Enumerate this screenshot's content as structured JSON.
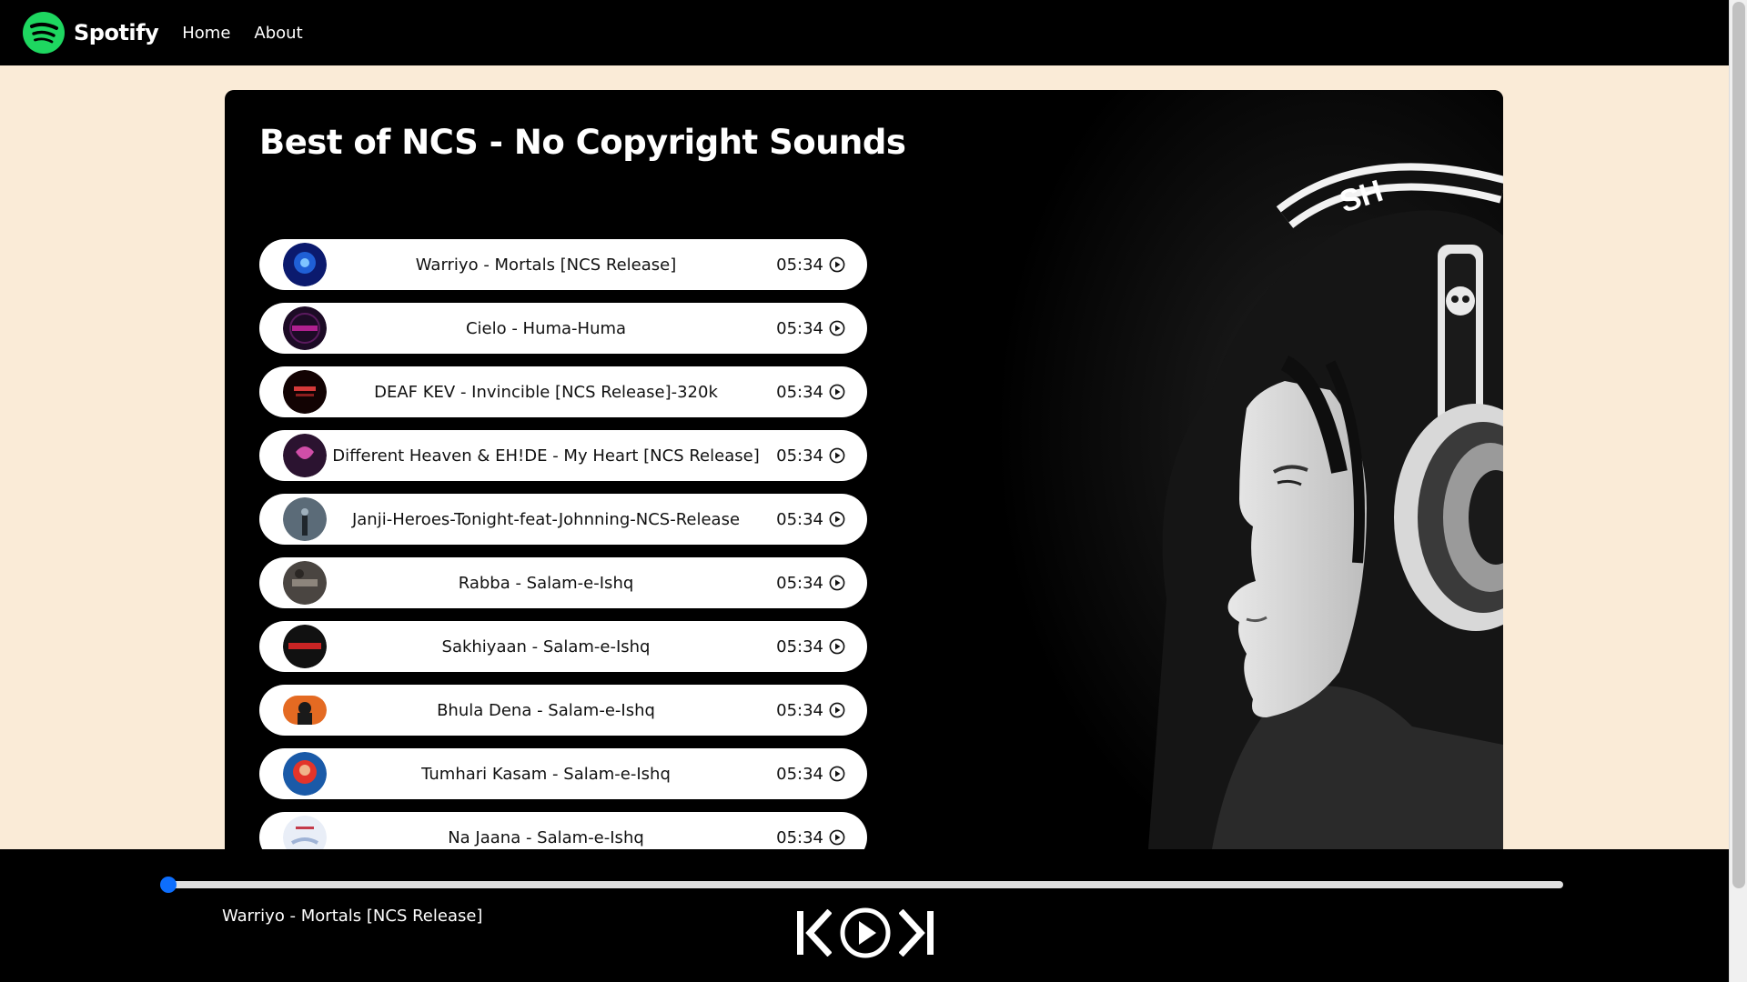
{
  "nav": {
    "brand": "Spotify",
    "links": [
      "Home",
      "About"
    ]
  },
  "playlist": {
    "title": "Best of NCS - No Copyright Sounds"
  },
  "songs": [
    {
      "name": "Warriyo - Mortals [NCS Release]",
      "duration": "05:34"
    },
    {
      "name": "Cielo - Huma-Huma",
      "duration": "05:34"
    },
    {
      "name": "DEAF KEV - Invincible [NCS Release]-320k",
      "duration": "05:34"
    },
    {
      "name": "Different Heaven & EH!DE - My Heart [NCS Release]",
      "duration": "05:34"
    },
    {
      "name": "Janji-Heroes-Tonight-feat-Johnning-NCS-Release",
      "duration": "05:34"
    },
    {
      "name": "Rabba - Salam-e-Ishq",
      "duration": "05:34"
    },
    {
      "name": "Sakhiyaan - Salam-e-Ishq",
      "duration": "05:34"
    },
    {
      "name": "Bhula Dena - Salam-e-Ishq",
      "duration": "05:34"
    },
    {
      "name": "Tumhari Kasam - Salam-e-Ishq",
      "duration": "05:34"
    },
    {
      "name": "Na Jaana - Salam-e-Ishq",
      "duration": "05:34"
    }
  ],
  "player": {
    "now_playing": "Warriyo - Mortals [NCS Release]",
    "progress": 0,
    "accent_color": "#0d6efd",
    "icons": [
      "previous-icon",
      "play-circle-icon",
      "next-icon"
    ]
  },
  "colors": {
    "page_background": "#faebd7",
    "nav_background": "#000000",
    "brand_green": "#1ed760"
  }
}
